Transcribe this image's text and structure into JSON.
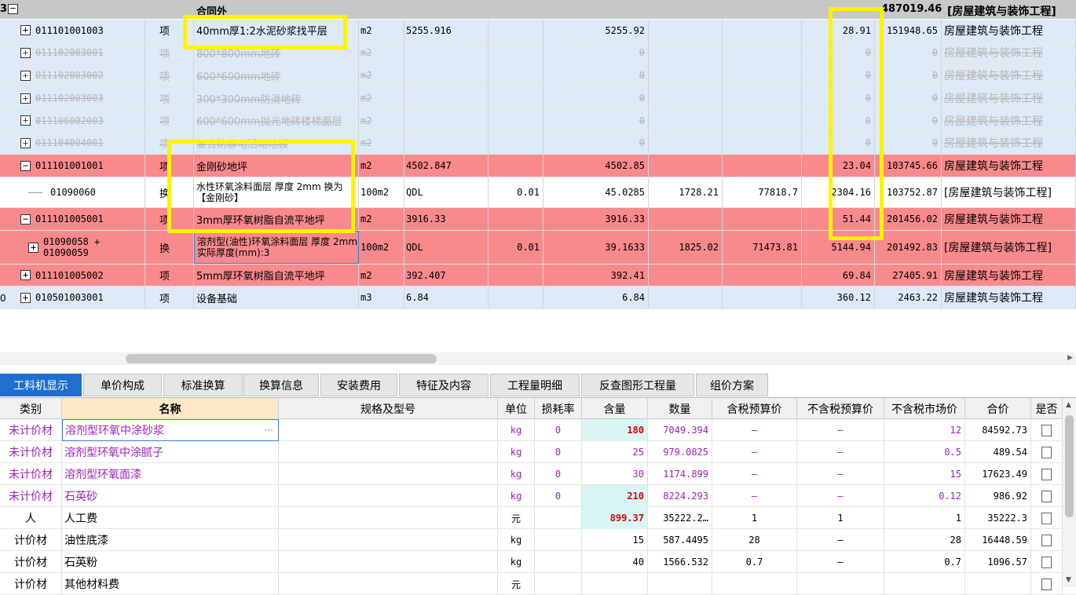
{
  "header_row": {
    "num": "3",
    "expander": "−",
    "name": "合同外",
    "total": "487019.46",
    "category": "[房屋建筑与装饰工程]"
  },
  "rows": [
    {
      "code": "011101001003",
      "expander": "+",
      "type": "项",
      "name": "40mm厚1:2水泥砂浆找平层",
      "unit": "m2",
      "expr": "5255.916",
      "coef": "",
      "qty": "5255.92",
      "price": "",
      "sum": "",
      "unit_price": "28.91",
      "total": "151948.65",
      "cat": "房屋建筑与装饰工程"
    },
    {
      "code": "011102003001",
      "expander": "+",
      "type": "项",
      "name": "800*800mm地砖",
      "unit": "m2",
      "expr": "",
      "coef": "",
      "qty": "0",
      "price": "",
      "sum": "",
      "unit_price": "0",
      "total": "0",
      "cat": "房屋建筑与装饰工程"
    },
    {
      "code": "011102003002",
      "expander": "+",
      "type": "项",
      "name": "600*600mm地砖",
      "unit": "m2",
      "expr": "",
      "coef": "",
      "qty": "0",
      "price": "",
      "sum": "",
      "unit_price": "0",
      "total": "0",
      "cat": "房屋建筑与装饰工程"
    },
    {
      "code": "011102003003",
      "expander": "+",
      "type": "项",
      "name": "300*300mm防滑地砖",
      "unit": "m2",
      "expr": "",
      "coef": "",
      "qty": "0",
      "price": "",
      "sum": "",
      "unit_price": "0",
      "total": "0",
      "cat": "房屋建筑与装饰工程"
    },
    {
      "code": "011106002003",
      "expander": "+",
      "type": "项",
      "name": "600*600mm抛光地砖楼梯面层",
      "unit": "m2",
      "expr": "",
      "coef": "",
      "qty": "0",
      "price": "",
      "sum": "",
      "unit_price": "0",
      "total": "0",
      "cat": "房屋建筑与装饰工程"
    },
    {
      "code": "011104004001",
      "expander": "+",
      "type": "项",
      "name": "复合防静电活动地板",
      "unit": "m2",
      "expr": "",
      "coef": "",
      "qty": "0",
      "price": "",
      "sum": "",
      "unit_price": "0",
      "total": "0",
      "cat": "房屋建筑与装饰工程"
    },
    {
      "code": "011101001001",
      "expander": "−",
      "type": "项",
      "name": "金刚砂地坪",
      "unit": "m2",
      "expr": "4502.847",
      "coef": "",
      "qty": "4502.85",
      "price": "",
      "sum": "",
      "unit_price": "23.04",
      "total": "103745.66",
      "cat": "房屋建筑与装饰工程"
    },
    {
      "code": "01090060",
      "expander": "",
      "type": "换",
      "name": "水性环氧涂料面层 厚度 2mm 换为【金刚砂】",
      "unit": "100m2",
      "expr": "QDL",
      "coef": "0.01",
      "qty": "45.0285",
      "price": "1728.21",
      "sum": "77818.7",
      "unit_price": "2304.16",
      "total": "103752.87",
      "cat": "[房屋建筑与装饰工程]"
    },
    {
      "code": "011101005001",
      "expander": "−",
      "type": "项",
      "name": "3mm厚环氧树脂自流平地坪",
      "unit": "m2",
      "expr": "3916.33",
      "coef": "",
      "qty": "3916.33",
      "price": "",
      "sum": "",
      "unit_price": "51.44",
      "total": "201456.02",
      "cat": "房屋建筑与装饰工程"
    },
    {
      "code": "01090058 + 01090059",
      "expander": "+",
      "type": "换",
      "name": "溶剂型(油性)环氧涂料面层 厚度 2mm  实际厚度(mm):3",
      "unit": "100m2",
      "expr": "QDL",
      "coef": "0.01",
      "qty": "39.1633",
      "price": "1825.02",
      "sum": "71473.81",
      "unit_price": "5144.94",
      "total": "201492.83",
      "cat": "[房屋建筑与装饰工程]"
    },
    {
      "code": "011101005002",
      "expander": "+",
      "type": "项",
      "name": "5mm厚环氧树脂自流平地坪",
      "unit": "m2",
      "expr": "392.407",
      "coef": "",
      "qty": "392.41",
      "price": "",
      "sum": "",
      "unit_price": "69.84",
      "total": "27405.91",
      "cat": "房屋建筑与装饰工程"
    },
    {
      "code": "010501003001",
      "expander": "+",
      "type": "项",
      "name": "设备基础",
      "unit": "m3",
      "expr": "6.84",
      "coef": "",
      "qty": "6.84",
      "price": "",
      "sum": "",
      "unit_price": "360.12",
      "total": "2463.22",
      "cat": "房屋建筑与装饰工程"
    }
  ],
  "row_side_number": "0",
  "tabs": [
    "工料机显示",
    "单价构成",
    "标准换算",
    "换算信息",
    "安装费用",
    "特征及内容",
    "工程量明细",
    "反查图形工程量",
    "组价方案"
  ],
  "grid_headers": [
    "类别",
    "名称",
    "规格及型号",
    "单位",
    "损耗率",
    "含量",
    "数量",
    "含税预算价",
    "不含税预算价",
    "不含税市场价",
    "合价",
    "是否"
  ],
  "grid_rows": [
    {
      "cat": "未计价材",
      "name": "溶剂型环氧中涂砂浆",
      "spec": "",
      "unit": "kg",
      "loss": "0",
      "content": "180",
      "qty": "7049.394",
      "taxp": "—",
      "ntaxp": "—",
      "mkt": "12",
      "sum": "84592.73"
    },
    {
      "cat": "未计价材",
      "name": "溶剂型环氧中涂腻子",
      "spec": "",
      "unit": "kg",
      "loss": "0",
      "content": "25",
      "qty": "979.0825",
      "taxp": "—",
      "ntaxp": "—",
      "mkt": "0.5",
      "sum": "489.54"
    },
    {
      "cat": "未计价材",
      "name": "溶剂型环氧面漆",
      "spec": "",
      "unit": "kg",
      "loss": "0",
      "content": "30",
      "qty": "1174.899",
      "taxp": "—",
      "ntaxp": "—",
      "mkt": "15",
      "sum": "17623.49"
    },
    {
      "cat": "未计价材",
      "name": "石英砂",
      "spec": "",
      "unit": "kg",
      "loss": "0",
      "content": "210",
      "qty": "8224.293",
      "taxp": "—",
      "ntaxp": "—",
      "mkt": "0.12",
      "sum": "986.92"
    },
    {
      "cat": "人",
      "name": "人工费",
      "spec": "",
      "unit": "元",
      "loss": "",
      "content": "899.37",
      "qty": "35222.2…",
      "taxp": "1",
      "ntaxp": "1",
      "mkt": "1",
      "sum": "35222.3"
    },
    {
      "cat": "计价材",
      "name": "油性底漆",
      "spec": "",
      "unit": "kg",
      "loss": "",
      "content": "15",
      "qty": "587.4495",
      "taxp": "28",
      "ntaxp": "—",
      "mkt": "28",
      "sum": "16448.59"
    },
    {
      "cat": "计价材",
      "name": "石英粉",
      "spec": "",
      "unit": "kg",
      "loss": "",
      "content": "40",
      "qty": "1566.532",
      "taxp": "0.7",
      "ntaxp": "—",
      "mkt": "0.7",
      "sum": "1096.57"
    },
    {
      "cat": "计价材",
      "name": "其他材料费",
      "spec": "",
      "unit": "元",
      "loss": "",
      "content": "",
      "qty": "",
      "taxp": "",
      "ntaxp": "",
      "mkt": "",
      "sum": ""
    }
  ],
  "edit_button": "···",
  "colors": {
    "blue_row": "#dde9f7",
    "red_row": "#f8898c",
    "highlight": "#fff200",
    "tab_active": "#1f6fd0",
    "purple_text": "#a020c0"
  }
}
